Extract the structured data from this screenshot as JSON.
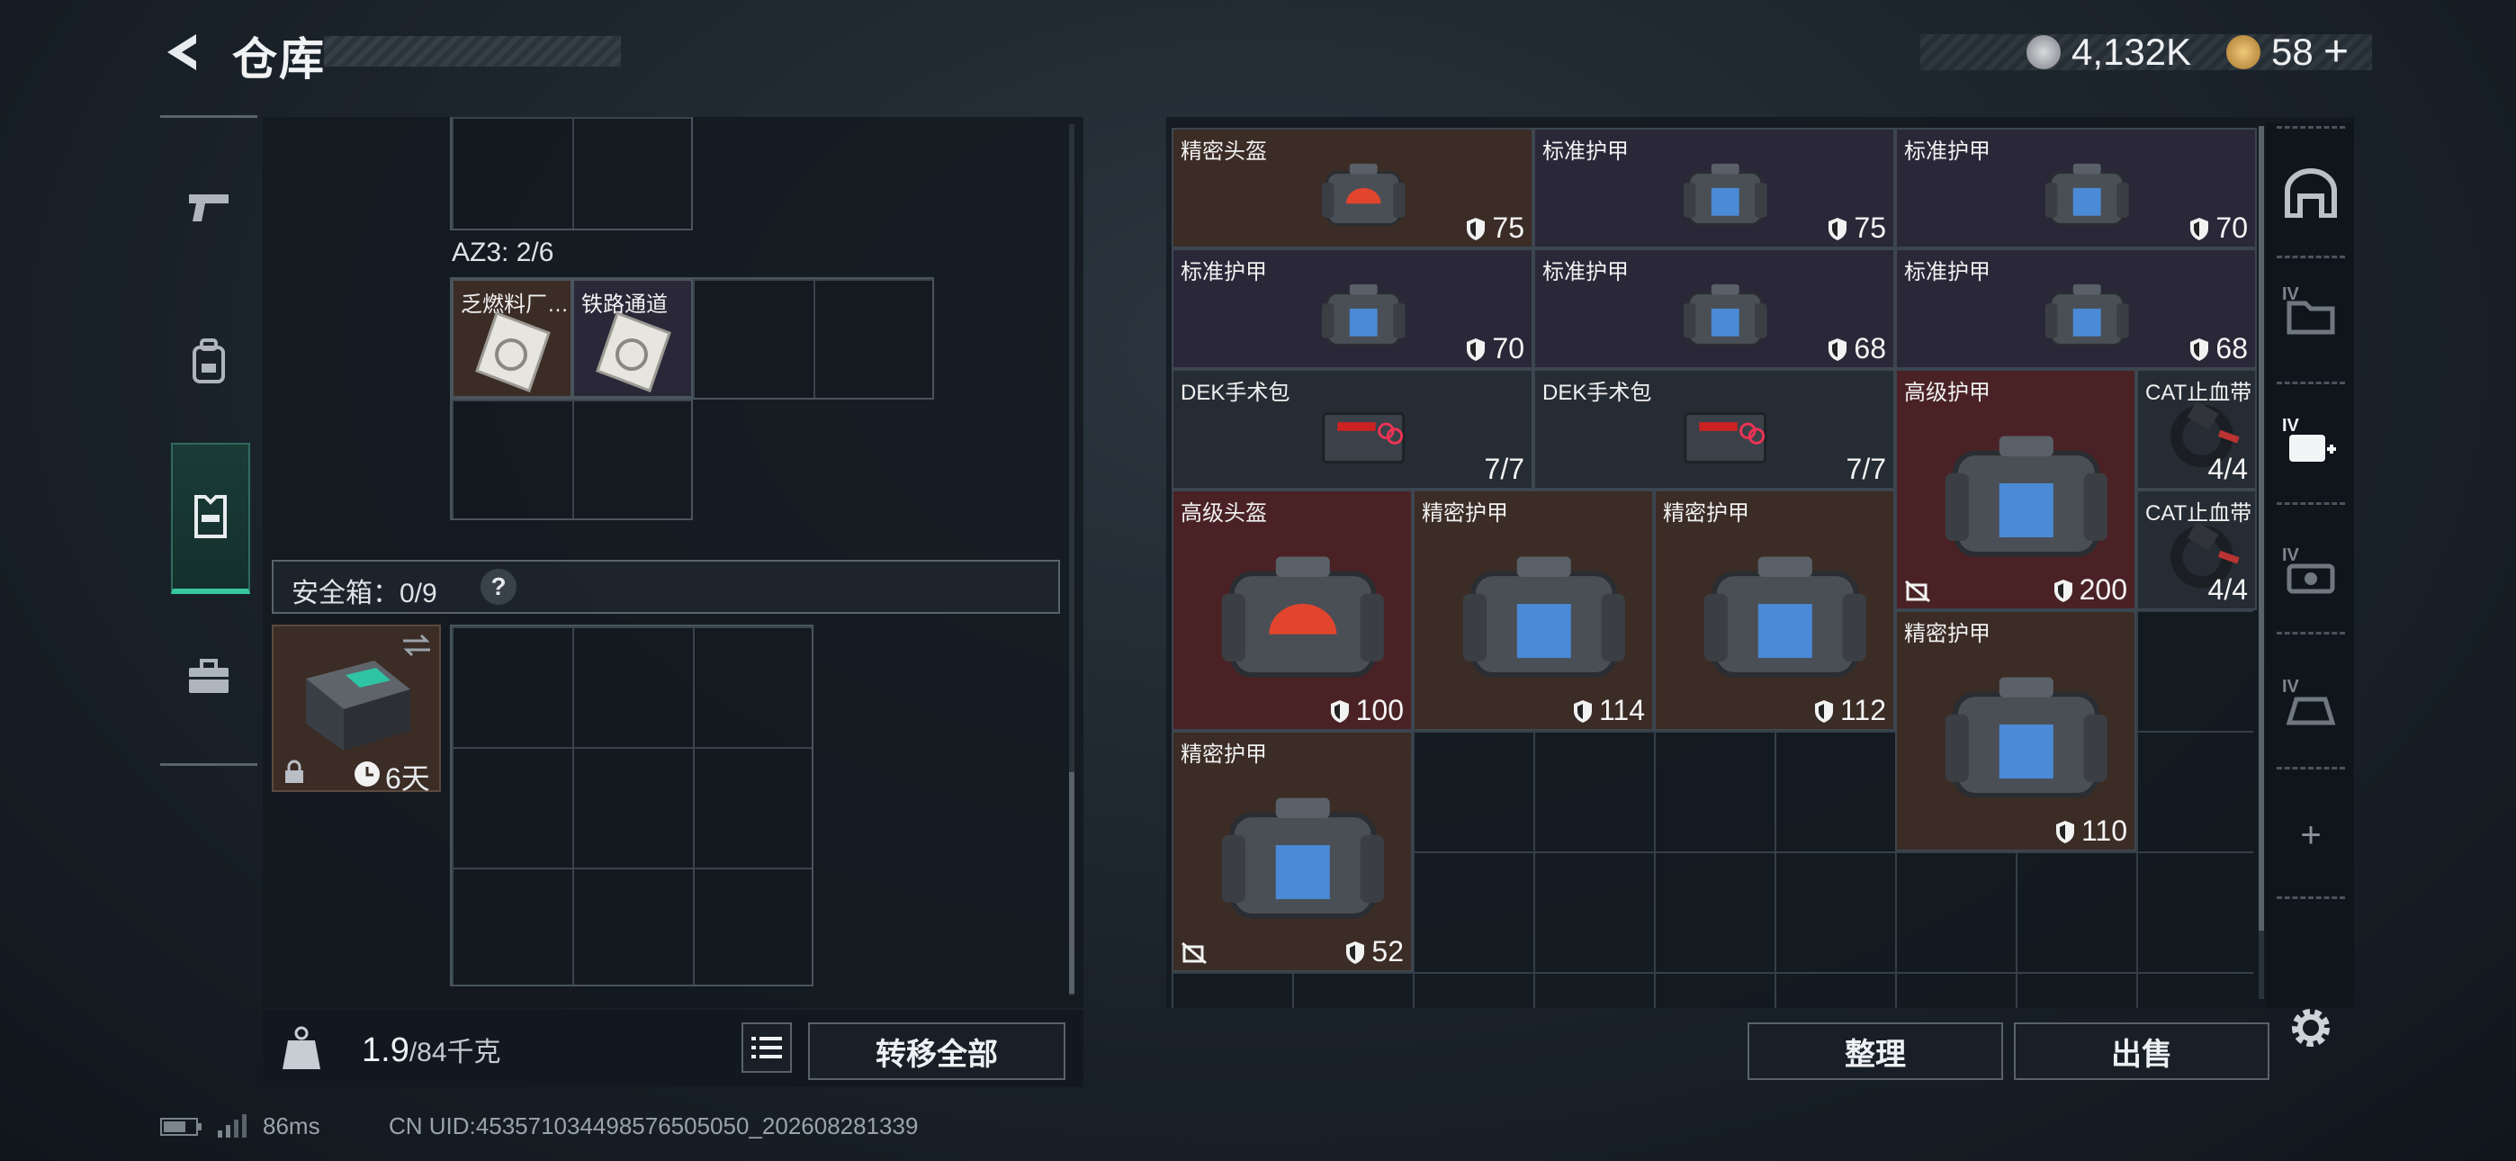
{
  "header": {
    "title": "仓库",
    "currency1": "4,132K",
    "currency2": "58",
    "plus": "+"
  },
  "left": {
    "az3_label": "AZ3: 2/6",
    "items": [
      {
        "name": "乏燃料厂…"
      },
      {
        "name": "铁路通道"
      }
    ],
    "safebox_label": "安全箱：0/9",
    "safebox_help": "?",
    "safebox_timer": "6天",
    "weight_value": "1.9",
    "weight_total": "/84千克",
    "transfer_all": "转移全部"
  },
  "right": {
    "items": [
      {
        "name": "精密头盔",
        "value": "75",
        "bg": "brown"
      },
      {
        "name": "标准护甲",
        "value": "75",
        "bg": "purple"
      },
      {
        "name": "标准护甲",
        "value": "70",
        "bg": "purple"
      },
      {
        "name": "标准护甲",
        "value": "70",
        "bg": "purple"
      },
      {
        "name": "标准护甲",
        "value": "68",
        "bg": "purple"
      },
      {
        "name": "标准护甲",
        "value": "68",
        "bg": "purple"
      },
      {
        "name": "DEK手术包",
        "value": "7/7",
        "bg": "gray"
      },
      {
        "name": "DEK手术包",
        "value": "7/7",
        "bg": "gray"
      },
      {
        "name": "高级护甲",
        "value": "200",
        "bg": "red"
      },
      {
        "name": "CAT止血带",
        "value": "4/4",
        "bg": "gray"
      },
      {
        "name": "CAT止血带",
        "value": "4/4",
        "bg": "gray"
      },
      {
        "name": "高级头盔",
        "value": "100",
        "bg": "red"
      },
      {
        "name": "精密护甲",
        "value": "114",
        "bg": "brown"
      },
      {
        "name": "精密护甲",
        "value": "112",
        "bg": "brown"
      },
      {
        "name": "精密护甲",
        "value": "110",
        "bg": "brown"
      },
      {
        "name": "精密护甲",
        "value": "52",
        "bg": "brown"
      }
    ],
    "sort_button": "整理",
    "sell_button": "出售",
    "side_tabs": [
      "IV",
      "IV",
      "IV",
      "IV",
      "+"
    ]
  },
  "status": {
    "ping": "86ms",
    "uid": "CN UID:453571034498576505050_202608281339"
  },
  "colors": {
    "accent": "#37c79d",
    "brown": "#3b2c25",
    "purple": "#2a2838",
    "red": "#4a2226"
  }
}
